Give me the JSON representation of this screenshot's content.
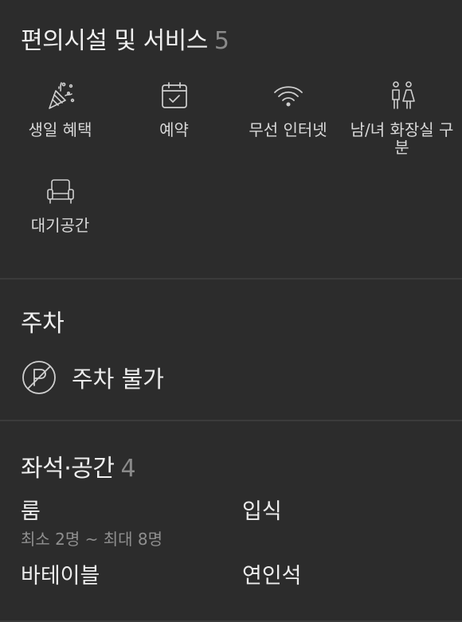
{
  "amenities": {
    "title": "편의시설 및 서비스",
    "count": "5",
    "items": [
      {
        "label": "생일 혜택",
        "icon": "party-popper-icon"
      },
      {
        "label": "예약",
        "icon": "calendar-check-icon"
      },
      {
        "label": "무선 인터넷",
        "icon": "wifi-icon"
      },
      {
        "label": "남/녀 화장실 구분",
        "icon": "restroom-icon"
      },
      {
        "label": "대기공간",
        "icon": "armchair-icon"
      }
    ]
  },
  "parking": {
    "title": "주차",
    "status": "주차 불가",
    "icon": "no-parking-icon"
  },
  "seating": {
    "title": "좌석·공간",
    "count": "4",
    "items": [
      {
        "name": "룸",
        "sub": "최소 2명 ~ 최대 8명"
      },
      {
        "name": "입식",
        "sub": ""
      },
      {
        "name": "바테이블",
        "sub": ""
      },
      {
        "name": "연인석",
        "sub": ""
      }
    ]
  },
  "colors": {
    "background": "#2c2c2c",
    "divider": "#3b3b3b",
    "text": "#e6e6e6",
    "muted": "#8a8a8a"
  }
}
